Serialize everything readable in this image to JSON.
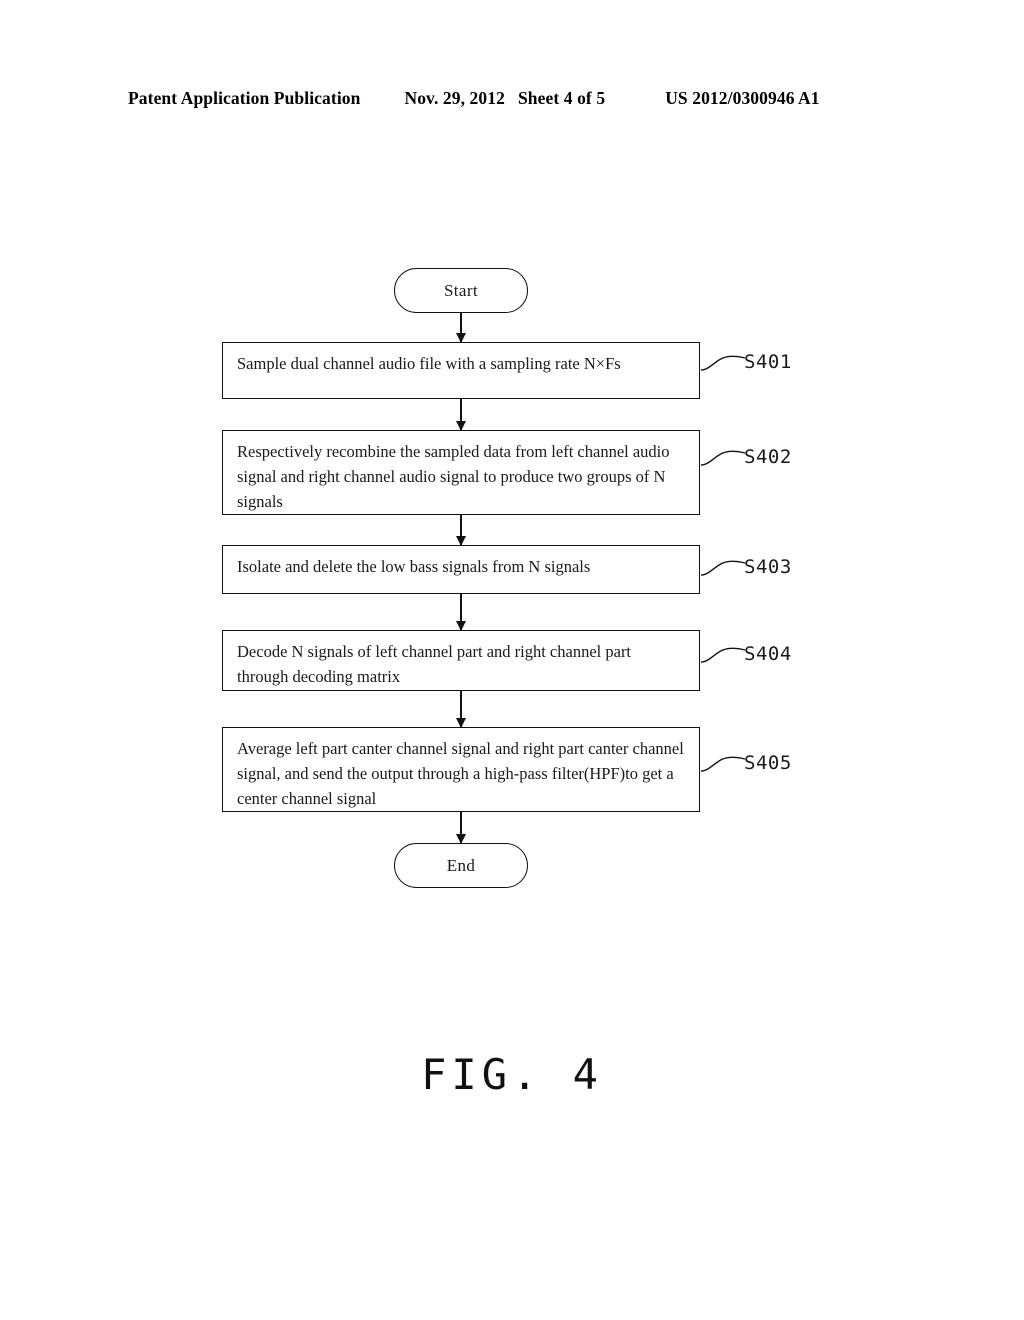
{
  "header": {
    "publication": "Patent Application Publication",
    "date": "Nov. 29, 2012",
    "sheet": "Sheet 4 of 5",
    "document_number": "US 2012/0300946 A1"
  },
  "figure": {
    "caption": "FIG. 4",
    "type": "flowchart"
  },
  "flowchart": {
    "start": {
      "label": "Start",
      "shape": "terminator"
    },
    "end": {
      "label": "End",
      "shape": "terminator"
    },
    "steps": [
      {
        "ref": "S401",
        "text": "Sample dual channel audio file with a sampling rate N×Fs"
      },
      {
        "ref": "S402",
        "text": "Respectively recombine the sampled data from left channel audio signal and right channel audio signal to produce two groups of N signals"
      },
      {
        "ref": "S403",
        "text": "Isolate and delete the low bass signals from N signals"
      },
      {
        "ref": "S404",
        "text": "Decode N signals of left channel part and right channel part through decoding matrix"
      },
      {
        "ref": "S405",
        "text": "Average left part canter channel signal and right part canter channel signal, and send the output through a high-pass filter(HPF)to get a center channel signal"
      }
    ]
  },
  "colors": {
    "ink": "#111111",
    "text": "#1a1a1a",
    "page_background": "#ffffff"
  }
}
